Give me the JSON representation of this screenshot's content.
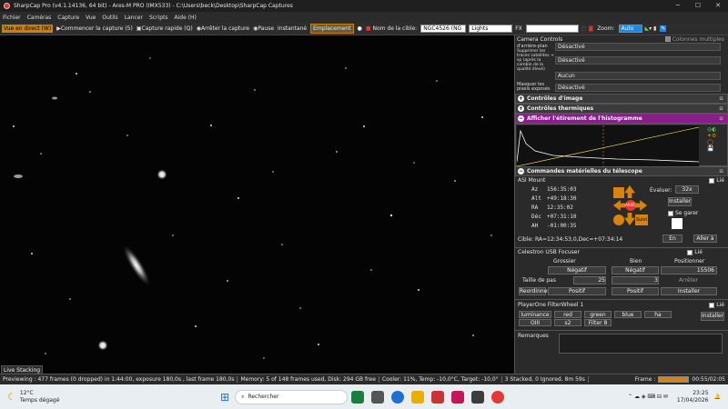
{
  "title": "SharpCap Pro (v4.1.14136, 64 bit) - Ares-M PRO (IMX533) - C:\\Users\\beck\\Desktop\\SharpCap Captures",
  "menu": [
    "Fichier",
    "Caméras",
    "Capture",
    "Vue",
    "Outils",
    "Lancer",
    "Scripts",
    "Aide (H)"
  ],
  "toolbar": {
    "live": "Vue en direct (W)",
    "start": "Commencer la capture (5)",
    "quick": "Capture rapide (Q)",
    "stop": "Arrêter la capture",
    "pause": "Pause",
    "snapshot": "Instantané",
    "location": "Emplacement",
    "target_label": "Nom de la cible:",
    "target": "NGC4526 (NG",
    "frame": "Lights",
    "fx": "FX",
    "zoom_label": "Zoom:",
    "zoom": "Auto"
  },
  "panel": {
    "camera_controls": "Camera Controls",
    "multi_columns": "Colonnes multiples",
    "bg": "d'arrière-plan",
    "bg_val": "Désactivé",
    "sat_label": "Supprimer les traces satellites + sp (après la combin de la qualité élevé)",
    "sat_val": "Désactivé",
    "r3_val": "Aucun",
    "mask_label": "Masquer les pixels exposés",
    "mask_val": "Désactivé",
    "image_controls": "Contrôles d'image",
    "thermal_controls": "Contrôles thermiques",
    "histogram": "Afficher l'étirement de l'histogramme",
    "telescope_controls": "Commandes matérielles du télescope",
    "asi_mount": "ASI Mount",
    "lie": "Lié",
    "az_l": "Az",
    "az": "156:35:03",
    "alt_l": "Alt",
    "alt": "+49:18:30",
    "ra_l": "RA",
    "ra": "12:35:02",
    "dec_l": "Déc",
    "dec": "+07:31:10",
    "ah_l": "AH",
    "ah": "-01:00:35",
    "evaluate": "Évaluer:",
    "rate": "32x",
    "install": "Installer",
    "stop": "ARRÊT",
    "park": "Se garer",
    "suivi": "Suivi",
    "cible": "Cible: RA=12:34:53,0,Dec=+07:34:14",
    "en": "En",
    "aller": "Aller à",
    "focuser": "Celestron USB Focuser",
    "grossier": "Grossier",
    "bien": "Bien",
    "positionner": "Positionner",
    "negatif": "Négatif",
    "position": "15506",
    "taille": "Taille de pas",
    "step1": "25",
    "step2": "3",
    "arreter": "Arrêter",
    "reordonner": "Reordinner",
    "positif": "Positif",
    "filterwheel": "PlayerOne FilterWheel 1",
    "filters": [
      "luminance",
      "red",
      "green",
      "blue",
      "ha",
      "OIII",
      "s2",
      "Filter 8"
    ],
    "remarques": "Remarques"
  },
  "live_stacking": "Live Stacking",
  "status": {
    "preview": "Previewing : 477 frames (0 dropped) in 1:44:00, exposure 180,0s , last frame 180,0s",
    "memory": "Memory: 5 of 148 frames used, Disk: 294 GB free",
    "cooler": "Cooler: 11%, Temp: -10,0°C, Target: -10,0°",
    "stacked": "3 Stacked, 0 Ignored, 8m 59s",
    "frame": "Frame :",
    "time": "00:55/02:05"
  },
  "taskbar": {
    "temp": "12°C",
    "weather": "Temps dégagé",
    "search": "Rechercher",
    "clock": "23:25",
    "date": "17/04/2026"
  }
}
